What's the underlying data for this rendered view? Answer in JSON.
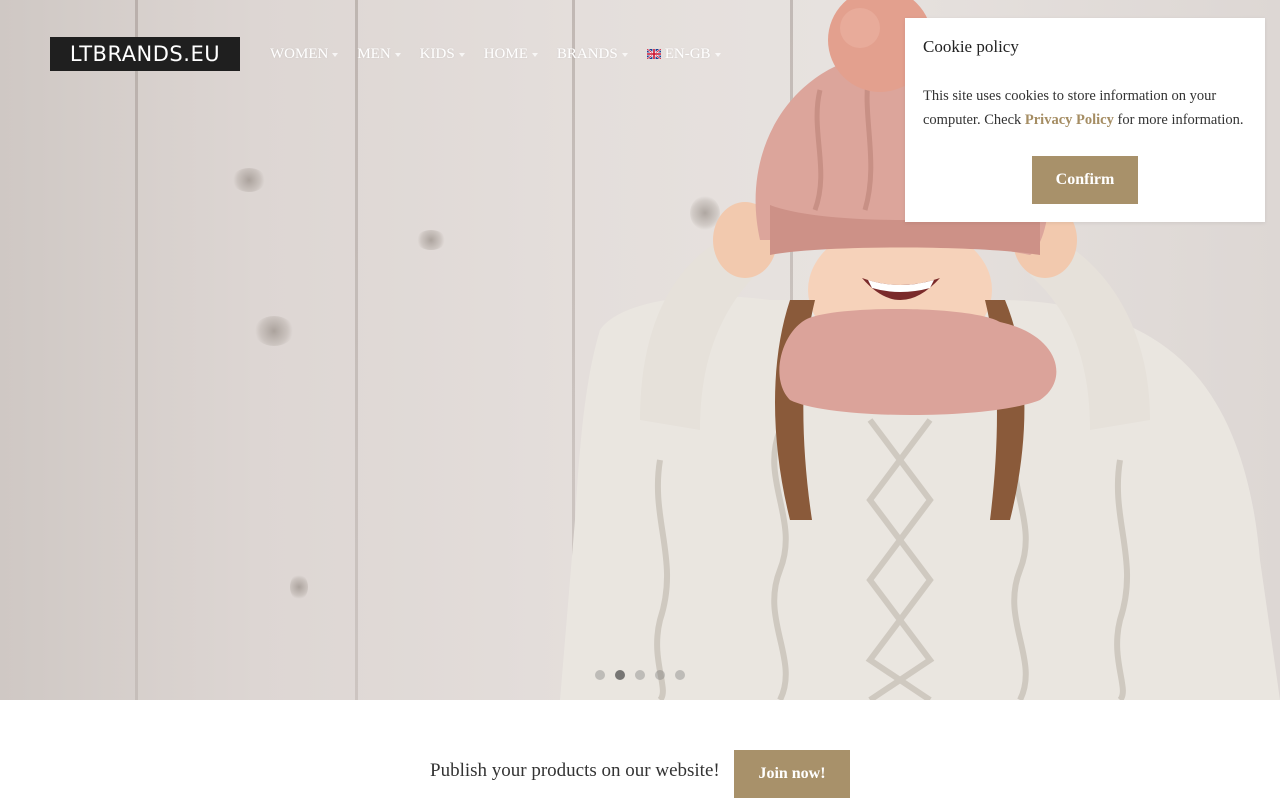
{
  "header": {
    "logo_text": "LTBRANDS.EU",
    "nav": [
      {
        "label": "WOMEN"
      },
      {
        "label": "MEN"
      },
      {
        "label": "KIDS"
      },
      {
        "label": "HOME"
      },
      {
        "label": "BRANDS"
      }
    ],
    "language": {
      "label": "EN-GB",
      "icon": "uk-flag-icon"
    }
  },
  "hero": {
    "slides_total": 5,
    "active_slide": 2
  },
  "cookie": {
    "title": "Cookie policy",
    "text_before": "This site uses cookies to store information on your computer. Check ",
    "link": "Privacy Policy",
    "text_after": " for more information.",
    "confirm": "Confirm"
  },
  "promo": {
    "text": "Publish your products on our website!",
    "button": "Join now!"
  },
  "colors": {
    "accent": "#a8916a",
    "link": "#a58d63",
    "logo_bg": "#1f1f1f"
  }
}
